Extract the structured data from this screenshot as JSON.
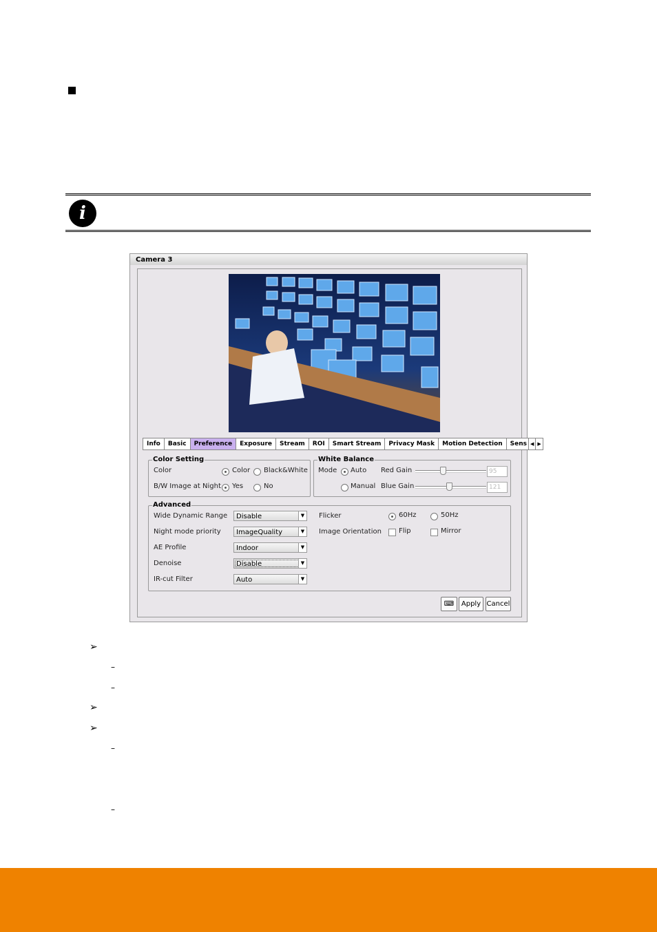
{
  "page": {
    "footer_color": "#ef8200",
    "bullet_icon": "black-square",
    "note_icon": "info-icon",
    "list_arrow_icon": "arrow-bullet",
    "list_dash_icon": "dash"
  },
  "dialog": {
    "title": "Camera 3",
    "tabs": [
      "Info",
      "Basic",
      "Preference",
      "Exposure",
      "Stream",
      "ROI",
      "Smart Stream",
      "Privacy Mask",
      "Motion Detection",
      "Sens"
    ],
    "active_tab": "Preference",
    "color_setting": {
      "label": "Color Setting",
      "color_label": "Color",
      "color_opt1": "Color",
      "color_opt2": "Black&White",
      "color_selected": "Color",
      "bw_label": "B/W Image at Night",
      "bw_opt1": "Yes",
      "bw_opt2": "No",
      "bw_selected": "Yes"
    },
    "white_balance": {
      "label": "White Balance",
      "mode_label": "Mode",
      "auto": "Auto",
      "manual": "Manual",
      "mode_selected": "Auto",
      "red_gain_label": "Red Gain",
      "red_gain": "95",
      "blue_gain_label": "Blue Gain",
      "blue_gain": "121"
    },
    "advanced": {
      "label": "Advanced",
      "wdr_label": "Wide Dynamic Range",
      "wdr": "Disable",
      "night_label": "Night mode priority",
      "night": "ImageQuality",
      "ae_label": "AE Profile",
      "ae": "Indoor",
      "denoise_label": "Denoise",
      "denoise": "Disable",
      "ircut_label": "IR-cut Filter",
      "ircut": "Auto",
      "flicker_label": "Flicker",
      "hz60": "60Hz",
      "hz50": "50Hz",
      "flicker_selected": "60Hz",
      "orient_label": "Image Orientation",
      "flip": "Flip",
      "mirror": "Mirror"
    },
    "buttons": {
      "apply": "Apply",
      "cancel": "Cancel"
    }
  }
}
